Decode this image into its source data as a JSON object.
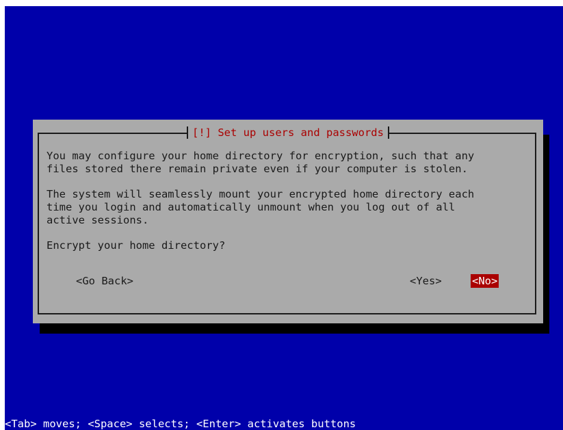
{
  "dialog": {
    "title": "[!] Set up users and passwords",
    "paragraph1": "You may configure your home directory for encryption, such that any\nfiles stored there remain private even if your computer is stolen.",
    "paragraph2": "The system will seamlessly mount your encrypted home directory each\ntime you login and automatically unmount when you log out of all\nactive sessions.",
    "question": "Encrypt your home directory?",
    "buttons": {
      "go_back": "<Go Back>",
      "yes": "<Yes>",
      "no": "<No>"
    },
    "selected_button": "no"
  },
  "statusbar": {
    "text": "<Tab> moves; <Space> selects; <Enter> activates buttons"
  },
  "colors": {
    "background": "#0000aa",
    "dialog": "#aaaaaa",
    "title": "#aa0000",
    "selected_button_bg": "#aa0000",
    "selected_button_fg": "#ffffff",
    "shadow": "#000000"
  }
}
